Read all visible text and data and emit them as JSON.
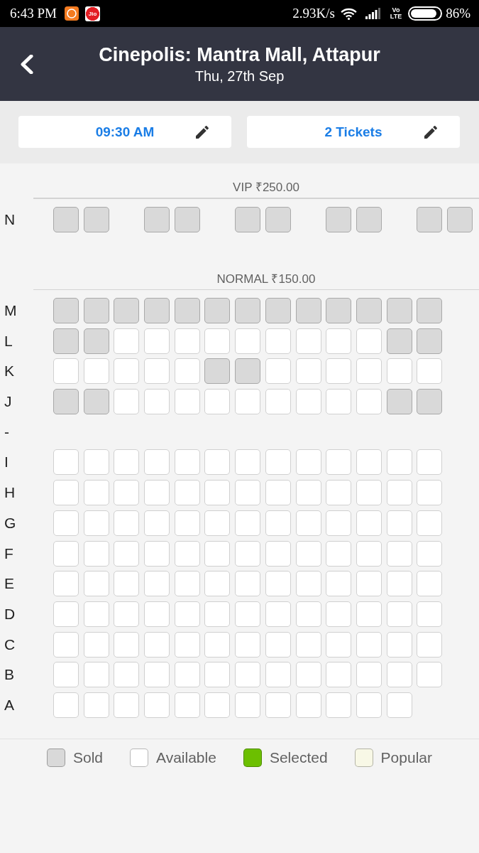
{
  "status_bar": {
    "time": "6:43 PM",
    "notification_logo": "Jio",
    "net_speed": "2.93K/s",
    "voice_label": "Vo",
    "network_type": "LTE",
    "battery": "86%"
  },
  "header": {
    "title": "Cinepolis: Mantra Mall, Attapur",
    "subtitle": "Thu, 27th Sep"
  },
  "selectors": [
    {
      "label": "09:30 AM"
    },
    {
      "label": "2 Tickets"
    }
  ],
  "sections": [
    {
      "title": "VIP ₹250.00",
      "rows": [
        {
          "label": "N",
          "seats": [
            {
              "kind": "seat",
              "sold": true
            },
            {
              "kind": "seat",
              "sold": true
            },
            {
              "kind": "gap"
            },
            {
              "kind": "seat",
              "sold": true
            },
            {
              "kind": "seat",
              "sold": true
            },
            {
              "kind": "gap"
            },
            {
              "kind": "seat",
              "sold": true
            },
            {
              "kind": "seat",
              "sold": true
            },
            {
              "kind": "gap"
            },
            {
              "kind": "seat",
              "sold": true
            },
            {
              "kind": "seat",
              "sold": true
            },
            {
              "kind": "gap"
            },
            {
              "kind": "seat",
              "sold": true
            },
            {
              "kind": "seat",
              "sold": true
            }
          ]
        }
      ]
    },
    {
      "title": "NORMAL ₹150.00",
      "rows": [
        {
          "label": "M",
          "seats": [
            {
              "kind": "seat",
              "sold": true
            },
            {
              "kind": "seat",
              "sold": true
            },
            {
              "kind": "seat",
              "sold": true
            },
            {
              "kind": "seat",
              "sold": true
            },
            {
              "kind": "seat",
              "sold": true
            },
            {
              "kind": "seat",
              "sold": true
            },
            {
              "kind": "seat",
              "sold": true
            },
            {
              "kind": "seat",
              "sold": true
            },
            {
              "kind": "seat",
              "sold": true
            },
            {
              "kind": "seat",
              "sold": true
            },
            {
              "kind": "seat",
              "sold": true
            },
            {
              "kind": "seat",
              "sold": true
            },
            {
              "kind": "seat",
              "sold": true
            }
          ]
        },
        {
          "label": "L",
          "seats": [
            {
              "kind": "seat",
              "sold": true
            },
            {
              "kind": "seat",
              "sold": true
            },
            {
              "kind": "seat",
              "sold": false
            },
            {
              "kind": "seat",
              "sold": false
            },
            {
              "kind": "seat",
              "sold": false
            },
            {
              "kind": "seat",
              "sold": false
            },
            {
              "kind": "seat",
              "sold": false
            },
            {
              "kind": "seat",
              "sold": false
            },
            {
              "kind": "seat",
              "sold": false
            },
            {
              "kind": "seat",
              "sold": false
            },
            {
              "kind": "seat",
              "sold": false
            },
            {
              "kind": "seat",
              "sold": true
            },
            {
              "kind": "seat",
              "sold": true
            }
          ]
        },
        {
          "label": "K",
          "seats": [
            {
              "kind": "seat",
              "sold": false
            },
            {
              "kind": "seat",
              "sold": false
            },
            {
              "kind": "seat",
              "sold": false
            },
            {
              "kind": "seat",
              "sold": false
            },
            {
              "kind": "seat",
              "sold": false
            },
            {
              "kind": "seat",
              "sold": true
            },
            {
              "kind": "seat",
              "sold": true
            },
            {
              "kind": "seat",
              "sold": false
            },
            {
              "kind": "seat",
              "sold": false
            },
            {
              "kind": "seat",
              "sold": false
            },
            {
              "kind": "seat",
              "sold": false
            },
            {
              "kind": "seat",
              "sold": false
            },
            {
              "kind": "seat",
              "sold": false
            }
          ]
        },
        {
          "label": "J",
          "seats": [
            {
              "kind": "seat",
              "sold": true
            },
            {
              "kind": "seat",
              "sold": true
            },
            {
              "kind": "seat",
              "sold": false
            },
            {
              "kind": "seat",
              "sold": false
            },
            {
              "kind": "seat",
              "sold": false
            },
            {
              "kind": "seat",
              "sold": false
            },
            {
              "kind": "seat",
              "sold": false
            },
            {
              "kind": "seat",
              "sold": false
            },
            {
              "kind": "seat",
              "sold": false
            },
            {
              "kind": "seat",
              "sold": false
            },
            {
              "kind": "seat",
              "sold": false
            },
            {
              "kind": "seat",
              "sold": true
            },
            {
              "kind": "seat",
              "sold": true
            }
          ]
        },
        {
          "label": "-"
        },
        {
          "label": "I",
          "seats": [
            {
              "kind": "seat",
              "sold": false
            },
            {
              "kind": "seat",
              "sold": false
            },
            {
              "kind": "seat",
              "sold": false
            },
            {
              "kind": "seat",
              "sold": false
            },
            {
              "kind": "seat",
              "sold": false
            },
            {
              "kind": "seat",
              "sold": false
            },
            {
              "kind": "seat",
              "sold": false
            },
            {
              "kind": "seat",
              "sold": false
            },
            {
              "kind": "seat",
              "sold": false
            },
            {
              "kind": "seat",
              "sold": false
            },
            {
              "kind": "seat",
              "sold": false
            },
            {
              "kind": "seat",
              "sold": false
            },
            {
              "kind": "seat",
              "sold": false
            }
          ]
        },
        {
          "label": "H",
          "seats": [
            {
              "kind": "seat",
              "sold": false
            },
            {
              "kind": "seat",
              "sold": false
            },
            {
              "kind": "seat",
              "sold": false
            },
            {
              "kind": "seat",
              "sold": false
            },
            {
              "kind": "seat",
              "sold": false
            },
            {
              "kind": "seat",
              "sold": false
            },
            {
              "kind": "seat",
              "sold": false
            },
            {
              "kind": "seat",
              "sold": false
            },
            {
              "kind": "seat",
              "sold": false
            },
            {
              "kind": "seat",
              "sold": false
            },
            {
              "kind": "seat",
              "sold": false
            },
            {
              "kind": "seat",
              "sold": false
            },
            {
              "kind": "seat",
              "sold": false
            }
          ]
        },
        {
          "label": "G",
          "seats": [
            {
              "kind": "seat",
              "sold": false
            },
            {
              "kind": "seat",
              "sold": false
            },
            {
              "kind": "seat",
              "sold": false
            },
            {
              "kind": "seat",
              "sold": false
            },
            {
              "kind": "seat",
              "sold": false
            },
            {
              "kind": "seat",
              "sold": false
            },
            {
              "kind": "seat",
              "sold": false
            },
            {
              "kind": "seat",
              "sold": false
            },
            {
              "kind": "seat",
              "sold": false
            },
            {
              "kind": "seat",
              "sold": false
            },
            {
              "kind": "seat",
              "sold": false
            },
            {
              "kind": "seat",
              "sold": false
            },
            {
              "kind": "seat",
              "sold": false
            }
          ]
        },
        {
          "label": "F",
          "seats": [
            {
              "kind": "seat",
              "sold": false
            },
            {
              "kind": "seat",
              "sold": false
            },
            {
              "kind": "seat",
              "sold": false
            },
            {
              "kind": "seat",
              "sold": false
            },
            {
              "kind": "seat",
              "sold": false
            },
            {
              "kind": "seat",
              "sold": false
            },
            {
              "kind": "seat",
              "sold": false
            },
            {
              "kind": "seat",
              "sold": false
            },
            {
              "kind": "seat",
              "sold": false
            },
            {
              "kind": "seat",
              "sold": false
            },
            {
              "kind": "seat",
              "sold": false
            },
            {
              "kind": "seat",
              "sold": false
            },
            {
              "kind": "seat",
              "sold": false
            }
          ]
        },
        {
          "label": "E",
          "seats": [
            {
              "kind": "seat",
              "sold": false
            },
            {
              "kind": "seat",
              "sold": false
            },
            {
              "kind": "seat",
              "sold": false
            },
            {
              "kind": "seat",
              "sold": false
            },
            {
              "kind": "seat",
              "sold": false
            },
            {
              "kind": "seat",
              "sold": false
            },
            {
              "kind": "seat",
              "sold": false
            },
            {
              "kind": "seat",
              "sold": false
            },
            {
              "kind": "seat",
              "sold": false
            },
            {
              "kind": "seat",
              "sold": false
            },
            {
              "kind": "seat",
              "sold": false
            },
            {
              "kind": "seat",
              "sold": false
            },
            {
              "kind": "seat",
              "sold": false
            }
          ]
        },
        {
          "label": "D",
          "seats": [
            {
              "kind": "seat",
              "sold": false
            },
            {
              "kind": "seat",
              "sold": false
            },
            {
              "kind": "seat",
              "sold": false
            },
            {
              "kind": "seat",
              "sold": false
            },
            {
              "kind": "seat",
              "sold": false
            },
            {
              "kind": "seat",
              "sold": false
            },
            {
              "kind": "seat",
              "sold": false
            },
            {
              "kind": "seat",
              "sold": false
            },
            {
              "kind": "seat",
              "sold": false
            },
            {
              "kind": "seat",
              "sold": false
            },
            {
              "kind": "seat",
              "sold": false
            },
            {
              "kind": "seat",
              "sold": false
            },
            {
              "kind": "seat",
              "sold": false
            }
          ]
        },
        {
          "label": "C",
          "seats": [
            {
              "kind": "seat",
              "sold": false
            },
            {
              "kind": "seat",
              "sold": false
            },
            {
              "kind": "seat",
              "sold": false
            },
            {
              "kind": "seat",
              "sold": false
            },
            {
              "kind": "seat",
              "sold": false
            },
            {
              "kind": "seat",
              "sold": false
            },
            {
              "kind": "seat",
              "sold": false
            },
            {
              "kind": "seat",
              "sold": false
            },
            {
              "kind": "seat",
              "sold": false
            },
            {
              "kind": "seat",
              "sold": false
            },
            {
              "kind": "seat",
              "sold": false
            },
            {
              "kind": "seat",
              "sold": false
            },
            {
              "kind": "seat",
              "sold": false
            }
          ]
        },
        {
          "label": "B",
          "seats": [
            {
              "kind": "seat",
              "sold": false
            },
            {
              "kind": "seat",
              "sold": false
            },
            {
              "kind": "seat",
              "sold": false
            },
            {
              "kind": "seat",
              "sold": false
            },
            {
              "kind": "seat",
              "sold": false
            },
            {
              "kind": "seat",
              "sold": false
            },
            {
              "kind": "seat",
              "sold": false
            },
            {
              "kind": "seat",
              "sold": false
            },
            {
              "kind": "seat",
              "sold": false
            },
            {
              "kind": "seat",
              "sold": false
            },
            {
              "kind": "seat",
              "sold": false
            },
            {
              "kind": "seat",
              "sold": false
            },
            {
              "kind": "seat",
              "sold": false
            }
          ]
        },
        {
          "label": "A",
          "seats": [
            {
              "kind": "seat",
              "sold": false
            },
            {
              "kind": "seat",
              "sold": false
            },
            {
              "kind": "seat",
              "sold": false
            },
            {
              "kind": "seat",
              "sold": false
            },
            {
              "kind": "seat",
              "sold": false
            },
            {
              "kind": "seat",
              "sold": false
            },
            {
              "kind": "seat",
              "sold": false
            },
            {
              "kind": "seat",
              "sold": false
            },
            {
              "kind": "seat",
              "sold": false
            },
            {
              "kind": "seat",
              "sold": false
            },
            {
              "kind": "seat",
              "sold": false
            },
            {
              "kind": "seat",
              "sold": false
            }
          ]
        }
      ]
    }
  ],
  "legend": [
    {
      "label": "Sold",
      "color": "#d9d9d9"
    },
    {
      "label": "Available",
      "color": "#ffffff"
    },
    {
      "label": "Selected",
      "color": "#6cbf00"
    },
    {
      "label": "Popular",
      "color": "#f8f8e6"
    }
  ]
}
